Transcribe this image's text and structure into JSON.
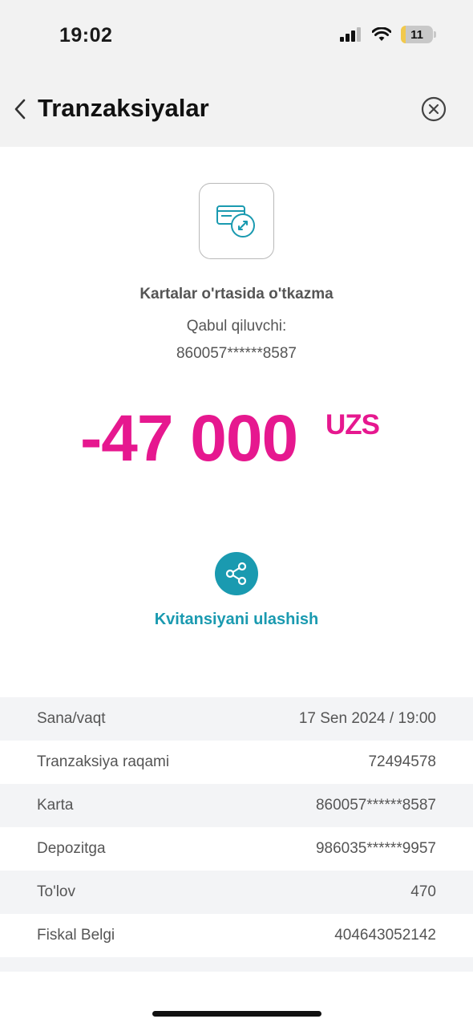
{
  "status_bar": {
    "time": "19:02",
    "battery": "11",
    "icons": [
      "signal-icon",
      "wifi-icon",
      "battery-icon"
    ]
  },
  "header": {
    "title": "Tranzaksiyalar",
    "back_icon": "chevron-left-icon",
    "close_icon": "close-circle-icon"
  },
  "transaction": {
    "type_label": "Kartalar o'rtasida o'tkazma",
    "recipient_label": "Qabul qiluvchi:",
    "recipient_card": "860057******8587",
    "amount": "-47 000",
    "currency": "UZS",
    "icon": "card-transfer-icon"
  },
  "share": {
    "label": "Kvitansiyani ulashish",
    "icon": "share-icon"
  },
  "details": [
    {
      "label": "Sana/vaqt",
      "value": "17 Sen 2024 / 19:00"
    },
    {
      "label": "Tranzaksiya raqami",
      "value": "72494578"
    },
    {
      "label": "Karta",
      "value": "860057******8587"
    },
    {
      "label": "Depozitga",
      "value": "986035******9957"
    },
    {
      "label": "To'lov",
      "value": "470"
    },
    {
      "label": "Fiskal Belgi",
      "value": "404643052142"
    }
  ],
  "colors": {
    "accent": "#1a9ab0",
    "amount": "#e6188f",
    "header_bg": "#f2f2f2",
    "row_shade": "#f3f4f6"
  }
}
